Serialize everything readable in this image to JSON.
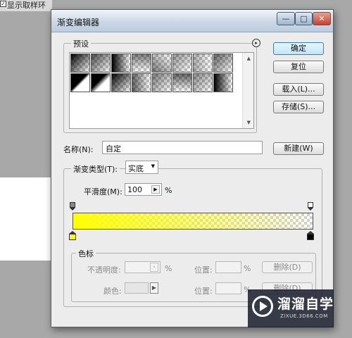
{
  "background": {
    "top_text": "显示取样环",
    "check_mark": "✓"
  },
  "dialog": {
    "title": "渐变编辑器",
    "window_buttons": {
      "minimize": "—",
      "maximize": "□",
      "close": "✕"
    },
    "presets": {
      "label": "预设",
      "menu_icon": "▸",
      "swatches": [
        {
          "a": "#000000",
          "b": "#ffffff"
        },
        {
          "a": "#000000",
          "b": "#ffffff"
        },
        {
          "a": "#000000",
          "b": "#ffffff"
        },
        {
          "a": "#000000",
          "b": "#ffffff"
        },
        {
          "a": "#000000",
          "b": "#ffffff"
        },
        {
          "a": "#000000",
          "b": "#ffffff"
        },
        {
          "a": "#000000",
          "b": "#ffffff"
        },
        {
          "a": "#000000",
          "b": "#ffffff"
        },
        {
          "a": "#000000",
          "b": "#ffffff"
        },
        {
          "a": "#000000",
          "b": "#ffffff"
        },
        {
          "a": "#000000",
          "b": "#ffffff"
        },
        {
          "a": "#000000",
          "b": "#ffffff"
        },
        {
          "a": "#000000",
          "b": "#ffffff"
        },
        {
          "a": "#000000",
          "b": "#ffffff"
        },
        {
          "a": "#000000",
          "b": "#ffffff"
        },
        {
          "a": "#000000",
          "b": "#ffffff"
        }
      ]
    },
    "buttons": {
      "ok": "确定",
      "reset": "复位",
      "load": "载入(L)...",
      "save": "存储(S)...",
      "new": "新建(W)"
    },
    "name": {
      "label": "名称(N):",
      "value": "自定"
    },
    "gradient": {
      "type_label": "渐变类型(T):",
      "type_value": "实底",
      "smoothness_label": "平滑度(M):",
      "smoothness_value": "100",
      "smoothness_unit": "%",
      "start_color": "#ffff00",
      "end_color": "#000000"
    },
    "stops": {
      "label": "色标",
      "opacity_label": "不透明度:",
      "opacity_unit": "%",
      "location_label": "位置:",
      "location_unit": "%",
      "delete_label": "删除(D)",
      "color_label": "颜色:",
      "location2_label": "位置:",
      "location2_unit": "%",
      "delete2_label": "删除(D)"
    }
  },
  "watermark": {
    "text": "溜溜自学",
    "url": "ZIXUE.3D66.COM"
  }
}
